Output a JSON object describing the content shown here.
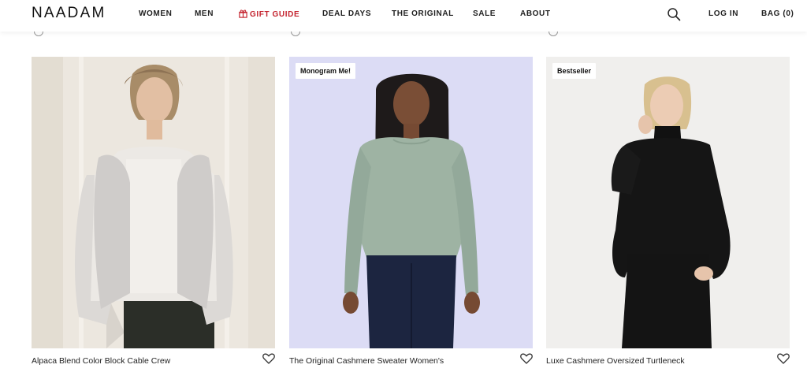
{
  "header": {
    "logo": "NAADAM",
    "nav": [
      {
        "label": "WOMEN"
      },
      {
        "label": "MEN"
      },
      {
        "label": "GIFT GUIDE"
      },
      {
        "label": "DEAL DAYS"
      },
      {
        "label": "THE ORIGINAL"
      },
      {
        "label": "SALE"
      },
      {
        "label": "ABOUT"
      }
    ],
    "search_icon": "search-icon",
    "login_label": "LOG IN",
    "bag_label": "BAG (0)",
    "gift_color": "#c4232e"
  },
  "products": [
    {
      "name": "Alpaca Blend Color Block Cable Crew",
      "badge": "",
      "photo_bg": "#ece7df"
    },
    {
      "name": "The Original Cashmere Sweater Women's",
      "badge": "Monogram Me!",
      "photo_bg": "#dcdcf5"
    },
    {
      "name": "Luxe Cashmere Oversized Turtleneck",
      "badge": "Bestseller",
      "photo_bg": "#f0efed"
    }
  ]
}
